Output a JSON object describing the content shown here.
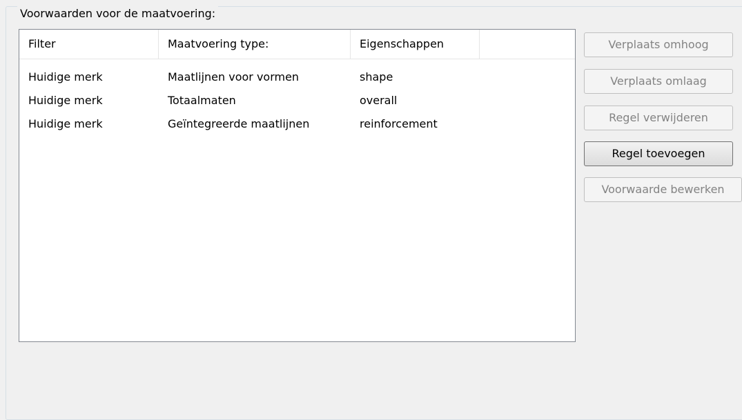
{
  "group": {
    "title": "Voorwaarden voor de maatvoering:"
  },
  "table": {
    "columns": [
      "Filter",
      "Maatvoering type:",
      "Eigenschappen",
      ""
    ],
    "rows": [
      [
        "Huidige merk",
        "Maatlijnen voor vormen",
        "shape"
      ],
      [
        "Huidige merk",
        "Totaalmaten",
        "overall"
      ],
      [
        "Huidige merk",
        "Geïntegreerde maatlijnen",
        "reinforcement"
      ]
    ]
  },
  "buttons": {
    "move_up": "Verplaats omhoog",
    "move_down": "Verplaats omlaag",
    "delete_rule": "Regel verwijderen",
    "add_rule": "Regel toevoegen",
    "edit_condition": "Voorwaarde bewerken"
  }
}
